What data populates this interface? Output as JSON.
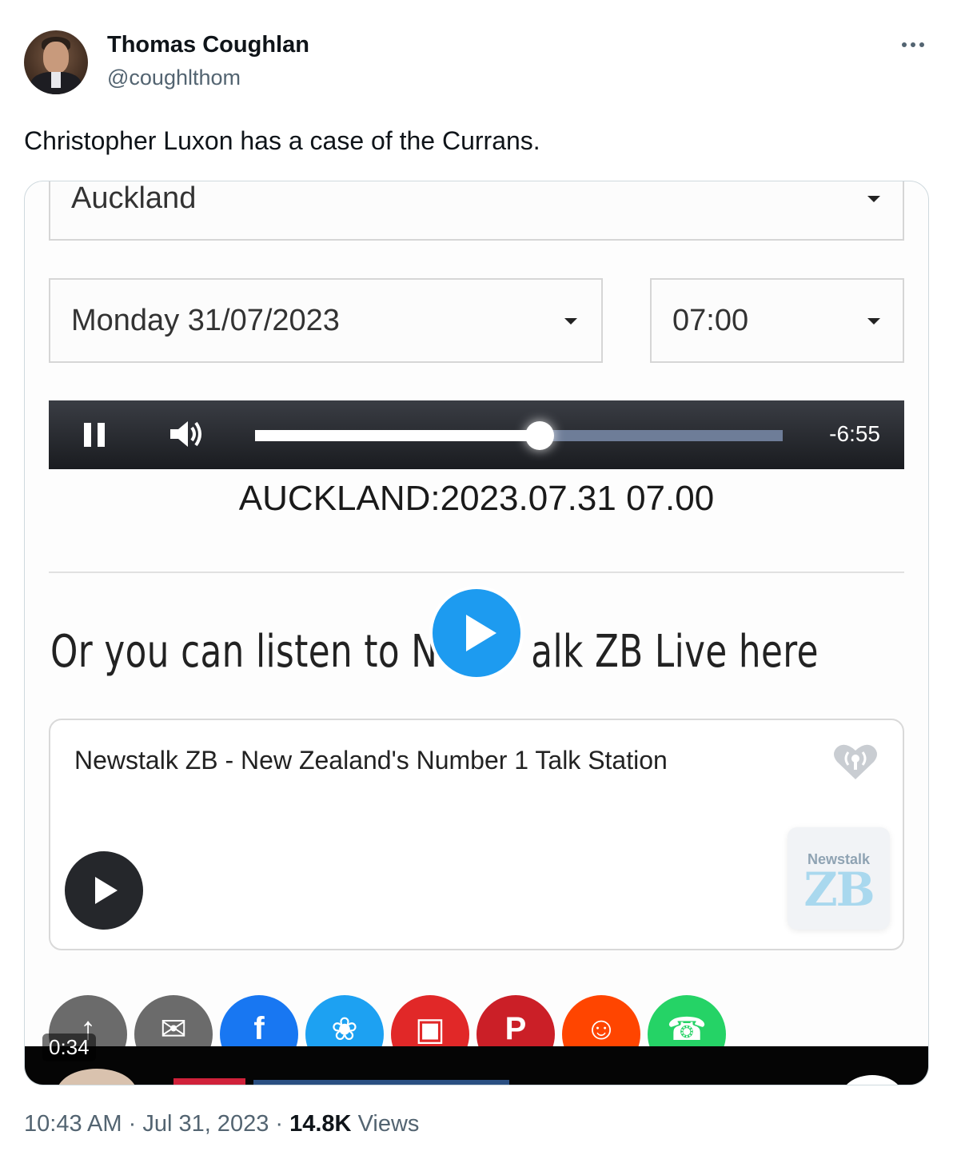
{
  "author": {
    "name": "Thomas Coughlan",
    "handle": "@coughlthom"
  },
  "tweet": {
    "text": "Christopher Luxon has a case of the Currans."
  },
  "media": {
    "region_select": "Auckland",
    "date_select": "Monday 31/07/2023",
    "time_select": "07:00",
    "player": {
      "time_remaining": "-6:55",
      "progress": 0.54
    },
    "caption": "AUCKLAND:2023.07.31 07.00",
    "listen_text_left": "Or you can listen to N",
    "listen_text_right": "alk ZB Live here",
    "station": {
      "title": "Newstalk ZB - New Zealand's Number 1 Talk Station",
      "logo_small": "Newstalk",
      "logo_big": "ZB"
    },
    "share_buttons": [
      {
        "name": "share",
        "icon": "share-icon",
        "color": "#6b6b6b"
      },
      {
        "name": "email",
        "icon": "mail-icon",
        "color": "#6b6b6b"
      },
      {
        "name": "facebook",
        "icon": "facebook-icon",
        "color": "#1877f2"
      },
      {
        "name": "twitter",
        "icon": "twitter-bird-icon",
        "color": "#1da1f2"
      },
      {
        "name": "flipboard",
        "icon": "flipboard-icon",
        "color": "#e12828"
      },
      {
        "name": "pinterest",
        "icon": "pinterest-icon",
        "color": "#cb1f27"
      },
      {
        "name": "reddit",
        "icon": "reddit-icon",
        "color": "#ff4500"
      },
      {
        "name": "whatsapp",
        "icon": "whatsapp-icon",
        "color": "#25d366"
      }
    ],
    "video_duration": "0:34"
  },
  "footer": {
    "time": "10:43 AM",
    "date": "Jul 31, 2023",
    "views_count": "14.8K",
    "views_label": "Views"
  },
  "colors": {
    "accent": "#1d9bf0",
    "secondary_text": "#536471"
  }
}
